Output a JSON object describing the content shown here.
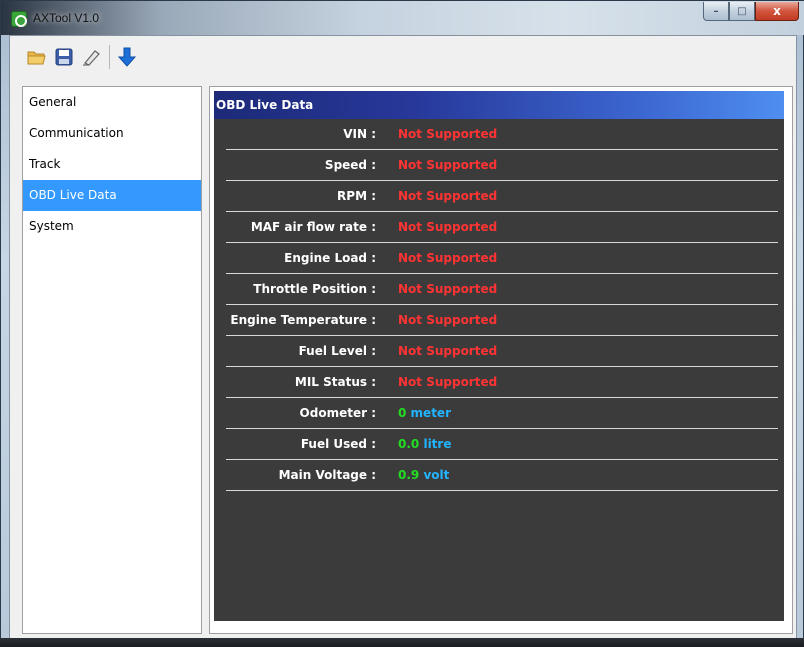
{
  "window": {
    "title": "AXTool V1.0",
    "controls": {
      "minimize": "–",
      "maximize": "□",
      "close": "x"
    }
  },
  "toolbar": {
    "buttons": [
      {
        "name": "open",
        "icon": "folder-open-icon"
      },
      {
        "name": "save",
        "icon": "floppy-disk-icon"
      },
      {
        "name": "edit",
        "icon": "eraser-icon"
      },
      {
        "name": "download",
        "icon": "arrow-down-icon"
      }
    ]
  },
  "sidebar": {
    "items": [
      {
        "label": "General",
        "active": false
      },
      {
        "label": "Communication",
        "active": false
      },
      {
        "label": "Track",
        "active": false
      },
      {
        "label": "OBD Live Data",
        "active": true
      },
      {
        "label": "System",
        "active": false
      }
    ]
  },
  "panel": {
    "title": "OBD Live Data",
    "rows": [
      {
        "label": "VIN :",
        "value": "Not Supported"
      },
      {
        "label": "Speed :",
        "value": "Not Supported"
      },
      {
        "label": "RPM :",
        "value": "Not Supported"
      },
      {
        "label": "MAF air flow rate :",
        "value": "Not Supported"
      },
      {
        "label": "Engine Load :",
        "value": "Not Supported"
      },
      {
        "label": "Throttle Position :",
        "value": "Not Supported"
      },
      {
        "label": "Engine Temperature :",
        "value": "Not Supported"
      },
      {
        "label": "Fuel Level :",
        "value": "Not Supported"
      },
      {
        "label": "MIL Status :",
        "value": "Not Supported"
      },
      {
        "label": "Odometer :",
        "number": "0",
        "unit": "meter"
      },
      {
        "label": "Fuel Used :",
        "number": "0.0",
        "unit": "litre"
      },
      {
        "label": "Main Voltage :",
        "number": "0.9",
        "unit": "volt"
      }
    ]
  },
  "colors": {
    "selection": "#3399ff",
    "not_supported": "#ff3333",
    "number": "#22dd22",
    "unit": "#22b4ff",
    "panel_bg": "#3b3b3b"
  }
}
